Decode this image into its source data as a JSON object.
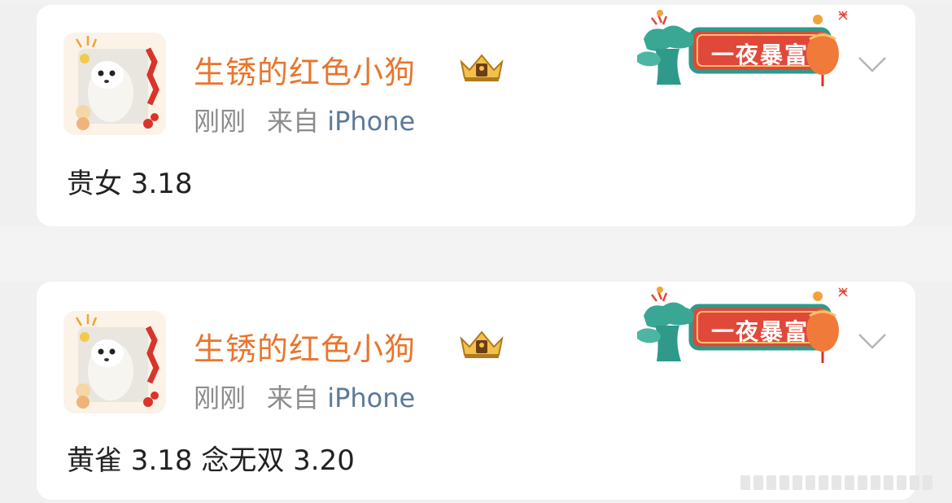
{
  "posts": [
    {
      "username": "生锈的红色小狗",
      "time": "刚刚",
      "source_prefix": "来自",
      "device": "iPhone",
      "text": "贵女 3.18",
      "badge": "一夜暴富"
    },
    {
      "username": "生锈的红色小狗",
      "time": "刚刚",
      "source_prefix": "来自",
      "device": "iPhone",
      "text": "黄雀 3.18 念无双 3.20",
      "badge": "一夜暴富"
    }
  ],
  "icons": {
    "avatar": "ferret-avatar-icon",
    "vip": "crown-vip-icon",
    "badge_decor": "lantern-cloud-icon",
    "more": "chevron-down-icon"
  },
  "colors": {
    "username": "#e8762d",
    "meta": "#8c8c8c",
    "device": "#5b7a99",
    "badge_bg": "#e0483a",
    "badge_border": "#2f9a8a"
  }
}
